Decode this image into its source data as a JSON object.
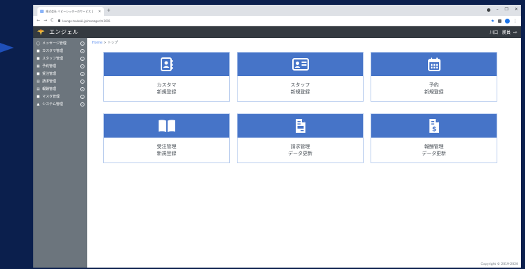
{
  "browser": {
    "tab_title": "株式会社 ベビーシッターのサービス |",
    "url": "lounge-tsubaki.jp/manager/m1001"
  },
  "header": {
    "brand": "エンジェル",
    "user_name": "川口　勝員"
  },
  "sidebar": {
    "items": [
      {
        "label": "メッセージ管理",
        "icon": "chat-icon"
      },
      {
        "label": "カスタマ管理",
        "icon": "customer-icon"
      },
      {
        "label": "スタッフ管理",
        "icon": "staff-icon"
      },
      {
        "label": "予約管理",
        "icon": "calendar-icon"
      },
      {
        "label": "受注管理",
        "icon": "book-icon"
      },
      {
        "label": "請求管理",
        "icon": "invoice-icon"
      },
      {
        "label": "報酬管理",
        "icon": "reward-icon"
      },
      {
        "label": "マスタ管理",
        "icon": "master-icon"
      },
      {
        "label": "システム管理",
        "icon": "system-icon"
      }
    ]
  },
  "breadcrumb": {
    "home": "Home",
    "separator": ">",
    "current": "トップ"
  },
  "cards": [
    {
      "line1": "カスタマ",
      "line2": "新規登録",
      "icon": "address-book-icon"
    },
    {
      "line1": "スタッフ",
      "line2": "新規登録",
      "icon": "id-card-icon"
    },
    {
      "line1": "予約",
      "line2": "新規登録",
      "icon": "calendar-icon"
    },
    {
      "line1": "受注管理",
      "line2": "新規登録",
      "icon": "open-book-icon"
    },
    {
      "line1": "請求管理",
      "line2": "データ更新",
      "icon": "invoice-icon"
    },
    {
      "line1": "報酬管理",
      "line2": "データ更新",
      "icon": "dollar-document-icon"
    }
  ],
  "footer": {
    "copyright": "Copyright © 2019-2020"
  },
  "colors": {
    "card_header": "#4674c8",
    "sidebar": "#6c757d",
    "app_header": "#343a40",
    "outer_bg": "#0b1f4d"
  }
}
